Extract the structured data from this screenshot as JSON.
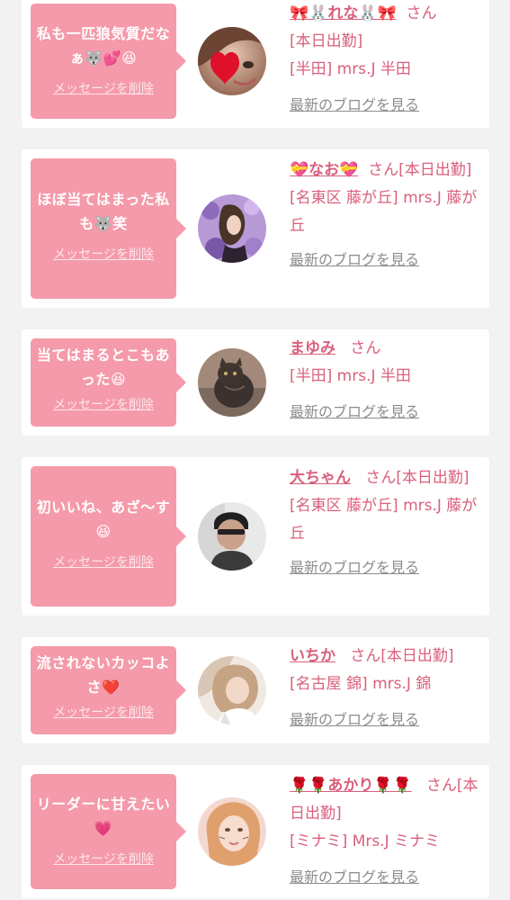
{
  "entries": [
    {
      "message": "私も一匹狼気質だなぁ🐺💕😆",
      "delete_label": "メッセージを削除",
      "name": "🎀🐰れな🐰🎀",
      "san": "さん",
      "status": "[本日出勤]",
      "shop": "[半田] mrs.J 半田",
      "blog_link": "最新のブログを見る"
    },
    {
      "message": "ほぼ当てはまった私も🐺笑",
      "delete_label": "メッセージを削除",
      "name": "💝なお💝",
      "san": "さん",
      "status": "[本日出勤]",
      "shop": "[名東区 藤が丘] mrs.J 藤が丘",
      "blog_link": "最新のブログを見る"
    },
    {
      "message": "当てはまるとこもあった😆",
      "delete_label": "メッセージを削除",
      "name": "まゆみ",
      "san": "さん",
      "status": "",
      "shop": "[半田] mrs.J 半田",
      "blog_link": "最新のブログを見る"
    },
    {
      "message": "初いいね、あざ〜す😆",
      "delete_label": "メッセージを削除",
      "name": "大ちゃん",
      "san": "さん",
      "status": "[本日出勤]",
      "shop": "[名東区 藤が丘] mrs.J 藤が丘",
      "blog_link": "最新のブログを見る"
    },
    {
      "message": "流されないカッコよさ❤️",
      "delete_label": "メッセージを削除",
      "name": "いちか",
      "san": "さん",
      "status": "[本日出勤]",
      "shop": "[名古屋 錦] mrs.J 錦",
      "blog_link": "最新のブログを見る"
    },
    {
      "message": "リーダーに甘えたい💗",
      "delete_label": "メッセージを削除",
      "name": "🌹🌹あかり🌹🌹",
      "san": "さん",
      "status": "[本日出勤]",
      "shop": "[ミナミ] Mrs.J ミナミ",
      "blog_link": "最新のブログを見る"
    }
  ],
  "colors": {
    "bubble": "#f59aaa",
    "accent_text": "#d9607c",
    "link_gray": "#8c8c8c",
    "background": "#f2f2f2"
  }
}
